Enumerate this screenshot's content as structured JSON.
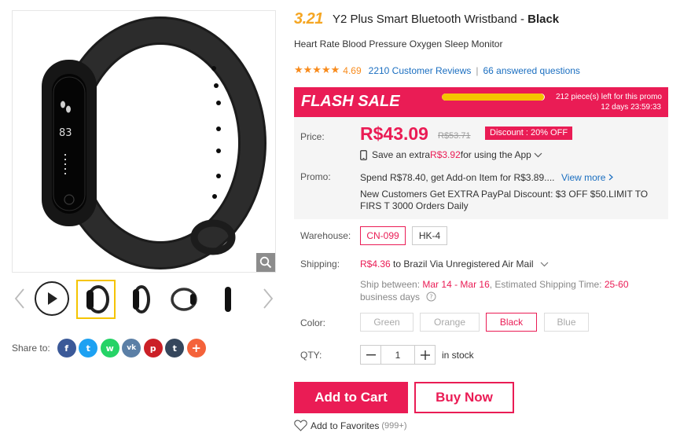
{
  "gallery": {
    "zoom_icon": "magnifier-icon",
    "thumb_count": 5,
    "active_thumb": 1
  },
  "share": {
    "label": "Share to:",
    "networks": [
      {
        "name": "facebook",
        "glyph": "f",
        "color": "#3b5998"
      },
      {
        "name": "twitter",
        "glyph": "t",
        "color": "#1da1f2"
      },
      {
        "name": "whatsapp",
        "glyph": "w",
        "color": "#25d366"
      },
      {
        "name": "vk",
        "glyph": "vk",
        "color": "#5b7fa6"
      },
      {
        "name": "pinterest",
        "glyph": "p",
        "color": "#cb2027"
      },
      {
        "name": "tumblr",
        "glyph": "t",
        "color": "#35465c"
      },
      {
        "name": "more",
        "glyph": "+",
        "color": "#f4623a"
      }
    ]
  },
  "product": {
    "promo_badge": "3.21",
    "title_main": "Y2 Plus Smart Bluetooth Wristband - ",
    "title_bold": "Black",
    "subtitle": "Heart Rate Blood Pressure Oxygen Sleep Monitor",
    "stars": "★★★★★",
    "rating": "4.69",
    "reviews": "2210 Customer Reviews",
    "separator": "|",
    "questions": "66 answered questions"
  },
  "flash_sale": {
    "title": "FLASH SALE",
    "progress": 0.99,
    "left_text": "212 piece(s) left for this promo",
    "countdown": "12 days 23:59:33"
  },
  "pricing": {
    "price_label": "Price:",
    "price": "R$43.09",
    "old_price": "R$53.71",
    "discount": "Discount : 20% OFF",
    "app_prefix": "Save an extra ",
    "app_amount": "R$3.92",
    "app_suffix": " for using the App",
    "promo_label": "Promo:",
    "promo_line1": "Spend R$78.40, get Add-on Item for R$3.89....",
    "promo_view_more": "View more",
    "promo_line2": "New Customers Get EXTRA PayPal Discount: $3 OFF $50.LIMIT TO FIRS T 3000 Orders Daily"
  },
  "warehouse": {
    "label": "Warehouse:",
    "options": [
      "CN-099",
      "HK-4"
    ],
    "selected": "CN-099"
  },
  "shipping": {
    "label": "Shipping:",
    "cost": "R$4.36",
    "method": " to Brazil Via Unregistered Air Mail",
    "between_prefix": "Ship between: ",
    "between_dates": "Mar 14 - Mar 16",
    "est_prefix": ", Estimated Shipping Time: ",
    "est_days": "25-60",
    "est_suffix": "business days"
  },
  "color": {
    "label": "Color:",
    "options": [
      "Green",
      "Orange",
      "Black",
      "Blue"
    ],
    "selected": "Black"
  },
  "quantity": {
    "label": "QTY:",
    "value": "1",
    "stock": "in stock"
  },
  "actions": {
    "add_to_cart": "Add to Cart",
    "buy_now": "Buy Now",
    "favorites": "Add to Favorites",
    "favorites_count": "(999+)"
  },
  "colors": {
    "accent": "#ea1c55",
    "link": "#1a6ec0",
    "star": "#f88b1c",
    "badge": "#f5a623"
  }
}
